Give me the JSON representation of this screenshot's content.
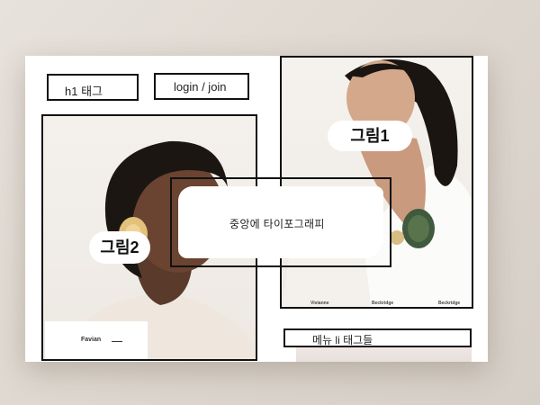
{
  "header": {
    "h1_label": "h1 태그",
    "login_label": "login / join"
  },
  "center": {
    "typography_label": "중앙에 타이포그래피"
  },
  "figures": {
    "fig1_label": "그림1",
    "fig2_label": "그림2"
  },
  "menu": {
    "label": "메뉴 li 태그들"
  },
  "captions": {
    "left_name": "Favian",
    "right_names": [
      "Vivianne",
      "Beckridge",
      "Beckridge"
    ]
  }
}
